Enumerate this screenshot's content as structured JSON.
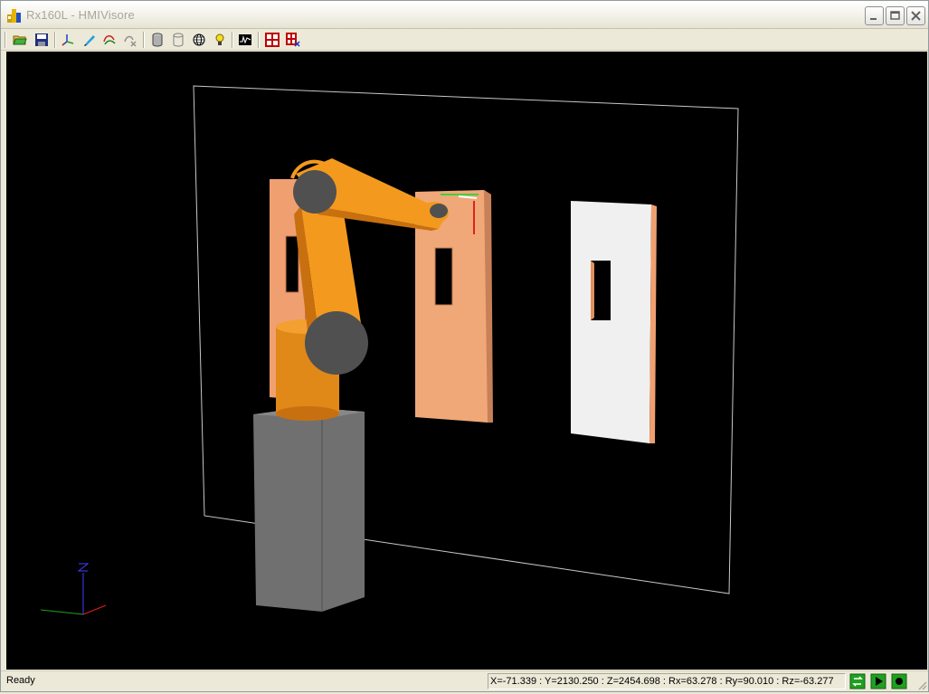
{
  "window": {
    "title": "Rx160L - HMIVisore"
  },
  "toolbar": {
    "buttons": [
      {
        "name": "open-folder-icon"
      },
      {
        "name": "save-icon"
      },
      {
        "name": "axes-icon"
      },
      {
        "name": "pen-icon"
      },
      {
        "name": "trajectory-icon"
      },
      {
        "name": "trajectory-remove-icon"
      },
      {
        "name": "cylinder-icon"
      },
      {
        "name": "cylinder-wire-icon"
      },
      {
        "name": "globe-icon"
      },
      {
        "name": "light-bulb-icon"
      },
      {
        "name": "oscilloscope-icon"
      },
      {
        "name": "grid-icon"
      },
      {
        "name": "grid-remove-icon"
      }
    ]
  },
  "status": {
    "ready": "Ready",
    "coords": "X=-71.339 : Y=2130.250 : Z=2454.698 : Rx=63.278 : Ry=90.010 : Rz=-63.277"
  },
  "colors": {
    "robot_orange": "#F39A1E",
    "panel_salmon": "#F0A878",
    "panel_white": "#F0F0F0",
    "base_gray": "#707070",
    "background": "#000000"
  }
}
